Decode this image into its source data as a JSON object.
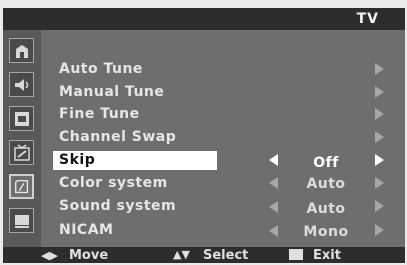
{
  "header": {
    "title": "TV"
  },
  "sidebar": {
    "icons": [
      {
        "name": "picture-icon"
      },
      {
        "name": "sound-icon"
      },
      {
        "name": "channel-icon"
      },
      {
        "name": "setup-icon"
      },
      {
        "name": "input-icon"
      },
      {
        "name": "application-icon"
      }
    ]
  },
  "menu": {
    "items": [
      {
        "label": "Auto Tune"
      },
      {
        "label": "Manual Tune"
      },
      {
        "label": "Fine Tune"
      },
      {
        "label": "Channel Swap"
      },
      {
        "label": "Skip",
        "value": "Off",
        "selected": true
      },
      {
        "label": "Color system",
        "value": "Auto"
      },
      {
        "label": "Sound system",
        "value": "Auto"
      },
      {
        "label": "NICAM",
        "value": "Mono"
      }
    ]
  },
  "footer": {
    "move": "Move",
    "select": "Select",
    "exit": "Exit"
  },
  "colors": {
    "frame": "#2d2d2d",
    "panel": "#6e6e6e",
    "sidebar": "#595959",
    "selected_bg": "#ffffff"
  }
}
